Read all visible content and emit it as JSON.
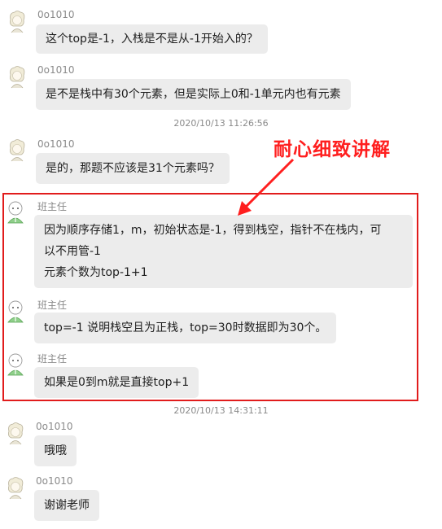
{
  "messages": [
    {
      "sender": "0o1010",
      "lines": [
        "这个top是-1，入栈是不是从-1开始入的？"
      ]
    },
    {
      "sender": "0o1010",
      "lines": [
        "是不是栈中有30个元素，但是实际上0和-1单元内也有元素"
      ]
    },
    {
      "timestamp": "2020/10/13 11:26:56"
    },
    {
      "sender": "0o1010",
      "lines": [
        "是的，那题不应该是31个元素吗？"
      ]
    },
    {
      "sender": "班主任",
      "lines": [
        "因为顺序存储1，m，初始状态是-1，得到栈空，指针不在栈内，可",
        "以不用管-1",
        "元素个数为top-1+1"
      ]
    },
    {
      "sender": "班主任",
      "lines": [
        "top=-1 说明栈空且为正栈，top=30时数据即为30个。"
      ]
    },
    {
      "sender": "班主任",
      "lines": [
        "如果是0到m就是直接top+1"
      ]
    },
    {
      "timestamp": "2020/10/13 14:31:11"
    },
    {
      "sender": "0o1010",
      "lines": [
        "哦哦"
      ]
    },
    {
      "sender": "0o1010",
      "lines": [
        "谢谢老师"
      ]
    }
  ],
  "annotation": {
    "text": "耐心细致讲解",
    "color": "#ff1f1f"
  },
  "colors": {
    "bubble": "#ececec",
    "highlight_border": "#e11c1c",
    "meta_text": "#8a8a8a"
  }
}
